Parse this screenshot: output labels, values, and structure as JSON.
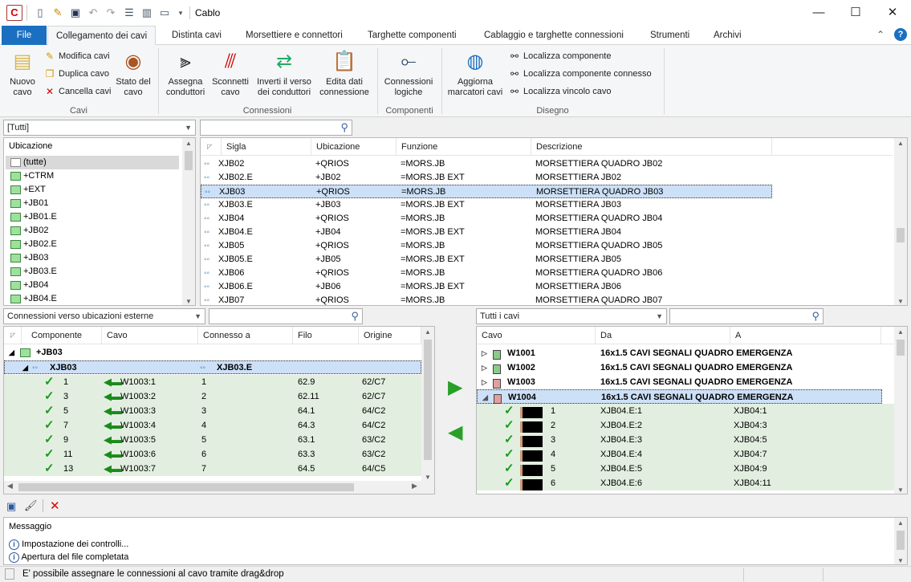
{
  "window": {
    "title": "Cablo",
    "minimize": "—",
    "maximize": "☐",
    "close": "✕"
  },
  "tabs": {
    "file": "File",
    "items": [
      "Collegamento dei cavi",
      "Distinta cavi",
      "Morsettiere e connettori",
      "Targhette componenti",
      "Cablaggio e targhette connessioni",
      "Strumenti",
      "Archivi"
    ]
  },
  "ribbon": {
    "cavi": {
      "nuovo": "Nuovo cavo",
      "modifica": "Modifica cavi",
      "duplica": "Duplica cavo",
      "cancella": "Cancella cavi",
      "stato": "Stato del cavo",
      "group": "Cavi"
    },
    "connessioni": {
      "assegna": "Assegna conduttori",
      "sconnetti": "Sconnetti cavo",
      "inverti": "Inverti il verso dei conduttori",
      "edita": "Edita dati connessione",
      "group": "Connessioni"
    },
    "componenti": {
      "logiche": "Connessioni logiche",
      "group": "Componenti"
    },
    "disegno": {
      "aggiorna": "Aggiorna marcatori cavi",
      "loc1": "Localizza componente",
      "loc2": "Localizza componente connesso",
      "loc3": "Localizza vincolo cavo",
      "group": "Disegno"
    }
  },
  "left_panel": {
    "combo": "[Tutti]",
    "header": "Ubicazione",
    "items": [
      "(tutte)",
      "+CTRM",
      "+EXT",
      "+JB01",
      "+JB01.E",
      "+JB02",
      "+JB02.E",
      "+JB03",
      "+JB03.E",
      "+JB04",
      "+JB04.E"
    ]
  },
  "components": {
    "headers": [
      "Sigla",
      "Ubicazione",
      "Funzione",
      "Descrizione"
    ],
    "rows": [
      [
        "XJB02",
        "+QRIOS",
        "=MORS.JB",
        "MORSETTIERA QUADRO JB02"
      ],
      [
        "XJB02.E",
        "+JB02",
        "=MORS.JB EXT",
        "MORSETTIERA JB02"
      ],
      [
        "XJB03",
        "+QRIOS",
        "=MORS.JB",
        "MORSETTIERA QUADRO JB03"
      ],
      [
        "XJB03.E",
        "+JB03",
        "=MORS.JB EXT",
        "MORSETTIERA JB03"
      ],
      [
        "XJB04",
        "+QRIOS",
        "=MORS.JB",
        "MORSETTIERA QUADRO JB04"
      ],
      [
        "XJB04.E",
        "+JB04",
        "=MORS.JB EXT",
        "MORSETTIERA JB04"
      ],
      [
        "XJB05",
        "+QRIOS",
        "=MORS.JB",
        "MORSETTIERA QUADRO JB05"
      ],
      [
        "XJB05.E",
        "+JB05",
        "=MORS.JB EXT",
        "MORSETTIERA JB05"
      ],
      [
        "XJB06",
        "+QRIOS",
        "=MORS.JB",
        "MORSETTIERA QUADRO JB06"
      ],
      [
        "XJB06.E",
        "+JB06",
        "=MORS.JB EXT",
        "MORSETTIERA JB06"
      ],
      [
        "XJB07",
        "+QRIOS",
        "=MORS.JB",
        "MORSETTIERA QUADRO JB07"
      ]
    ]
  },
  "ext_conn": {
    "combo": "Connessioni verso ubicazioni esterne",
    "headers": [
      "Componente",
      "Cavo",
      "Connesso a",
      "Filo",
      "Origine"
    ],
    "group": "+JB03",
    "comp": "XJB03",
    "comp_to": "XJB03.E",
    "rows": [
      [
        "1",
        "W1003:1",
        "1",
        "62.9",
        "62/C7"
      ],
      [
        "3",
        "W1003:2",
        "2",
        "62.11",
        "62/C7"
      ],
      [
        "5",
        "W1003:3",
        "3",
        "64.1",
        "64/C2"
      ],
      [
        "7",
        "W1003:4",
        "4",
        "64.3",
        "64/C2"
      ],
      [
        "9",
        "W1003:5",
        "5",
        "63.1",
        "63/C2"
      ],
      [
        "11",
        "W1003:6",
        "6",
        "63.3",
        "63/C2"
      ],
      [
        "13",
        "W1003:7",
        "7",
        "64.5",
        "64/C5"
      ]
    ]
  },
  "cables": {
    "combo": "Tutti i cavi",
    "headers": [
      "Cavo",
      "Da",
      "A"
    ],
    "items": [
      [
        "W1001",
        "16x1.5 CAVI SEGNALI QUADRO EMERGENZA"
      ],
      [
        "W1002",
        "16x1.5 CAVI SEGNALI QUADRO EMERGENZA"
      ],
      [
        "W1003",
        "16x1.5 CAVI SEGNALI QUADRO EMERGENZA"
      ],
      [
        "W1004",
        "16x1.5 CAVI SEGNALI QUADRO EMERGENZA"
      ]
    ],
    "conductors": [
      [
        "1",
        "XJB04.E:1",
        "XJB04:1"
      ],
      [
        "2",
        "XJB04.E:2",
        "XJB04:3"
      ],
      [
        "3",
        "XJB04.E:3",
        "XJB04:5"
      ],
      [
        "4",
        "XJB04.E:4",
        "XJB04:7"
      ],
      [
        "5",
        "XJB04.E:5",
        "XJB04:9"
      ],
      [
        "6",
        "XJB04.E:6",
        "XJB04:11"
      ]
    ]
  },
  "messages": {
    "header": "Messaggio",
    "items": [
      "Impostazione dei controlli...",
      "Apertura del file completata"
    ]
  },
  "status": "E' possibile assegnare le connessioni al cavo tramite drag&drop"
}
